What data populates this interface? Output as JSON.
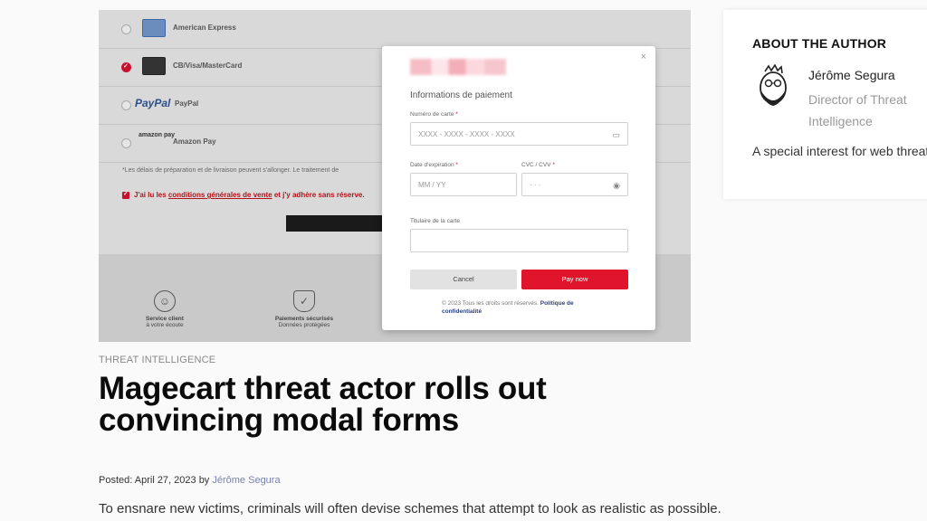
{
  "hero": {
    "payment_methods": [
      {
        "label": "American Express",
        "checked": false,
        "logo": "amex-logo"
      },
      {
        "label": "CB/Visa/MasterCard",
        "checked": true,
        "logo": "card-logo"
      },
      {
        "label": "PayPal",
        "checked": false,
        "logo": "paypal-logo",
        "logo_text": "PayPal"
      },
      {
        "label": "Amazon Pay",
        "checked": false,
        "logo": "amazon-pay-logo",
        "logo_text": "amazon pay"
      }
    ],
    "fine_note": "*Les délais de préparation et de livraison peuvent s'allonger. Le traitement de ",
    "cgv_prefix": "J'ai lu les ",
    "cgv_link": "conditions générales de vente",
    "cgv_suffix": " et j'y adhère sans réserve.",
    "features": [
      {
        "title": "Service client",
        "subtitle": "à votre écoute",
        "icon": "smiley-icon"
      },
      {
        "title": "Paiements sécurisés",
        "subtitle": "Données protégées",
        "icon": "shield-check-icon"
      }
    ],
    "modal": {
      "close_glyph": "×",
      "section_title": "Informations de paiement",
      "card_number_label": "Numéro de carte",
      "card_number_placeholder": "XXXX - XXXX - XXXX - XXXX",
      "expiry_label": "Date d'expiration",
      "expiry_placeholder": "MM / YY",
      "cvc_label": "CVC / CVV",
      "cvc_placeholder": "· · ·",
      "holder_label": "Titulaire de la carte",
      "holder_placeholder": "",
      "required_mark": "*",
      "cancel_label": "Cancel",
      "pay_label": "Pay now",
      "copyright_text": "© 2023 Tous les droits sont réservés.",
      "copyright_link": "Politique de confidentialité"
    }
  },
  "article": {
    "category": "THREAT INTELLIGENCE",
    "title": "Magecart threat actor rolls out convincing modal forms",
    "posted_prefix": "Posted: April 27, 2023 by ",
    "author_link": "Jérôme Segura",
    "lead": "To ensnare new victims, criminals will often devise schemes that attempt to look as realistic as possible."
  },
  "author_card": {
    "heading": "ABOUT THE AUTHOR",
    "name": "Jérôme Segura",
    "role": "Director of Threat Intelligence",
    "bio": "A special interest for web threats"
  },
  "colors": {
    "brand_red": "#e0142a",
    "link_muted": "#7a82a8"
  }
}
